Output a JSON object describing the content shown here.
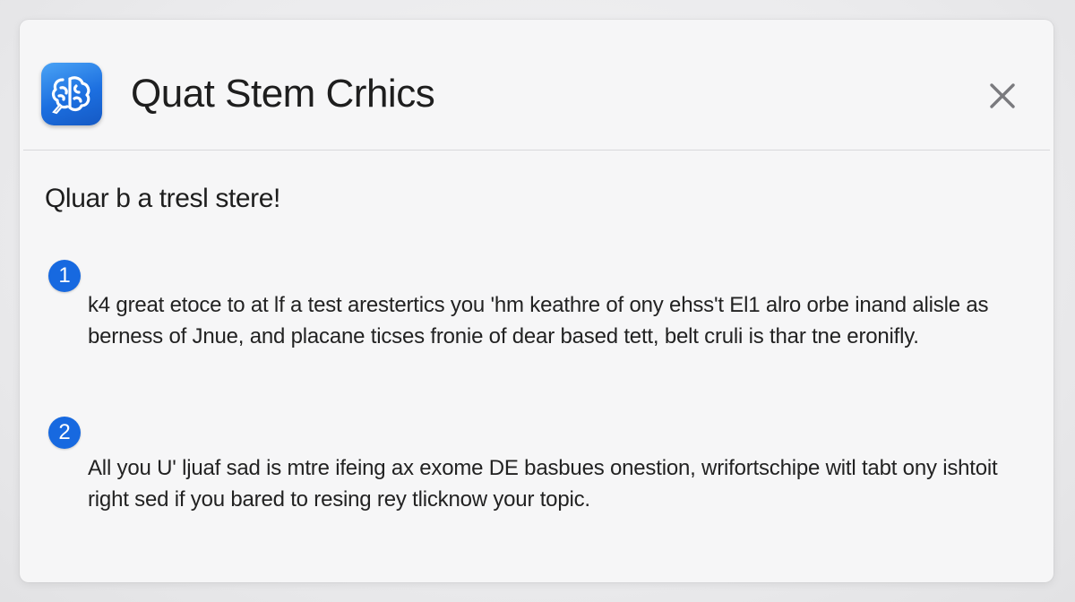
{
  "dialog": {
    "title": "Quat Stem Crhics",
    "icon": "brain-app-icon",
    "close_icon": "close-icon",
    "subheading": "Qluar b a tresl stere!",
    "steps": [
      {
        "number": "1",
        "text": "k4 great etoce to at lf a test arestertics you 'hm keathre of ony ehss't El1 alro orbe inand alisle as berness of Jnue, and placane ticses fronie of dear based tett, belt cruli is thar tne eronifly."
      },
      {
        "number": "2",
        "text": "All you U' ljuaf sad is mtre ifeing ax exome DE basbues onestion, wrifortschipe witl tabt ony ishtoit right sed if you bared to resing rey tlicknow your topic."
      }
    ]
  },
  "colors": {
    "accent": "#1769e0",
    "background": "#f6f6f7",
    "text": "#1e1e1e"
  }
}
